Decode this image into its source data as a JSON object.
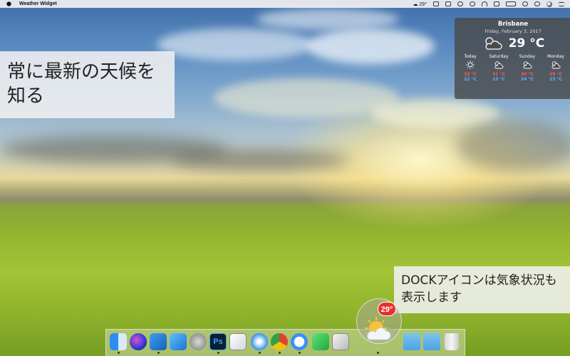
{
  "menubar": {
    "app_name": "Weather Widget",
    "weather_status": "29°"
  },
  "captions": {
    "left": "常に最新の天候を知る",
    "right": "DOCKアイコンは気象状況も表示します"
  },
  "widget": {
    "city": "Brisbane",
    "date": "Friday, February 3, 2017",
    "current_temp": "29 °C",
    "current_icon": "partly-cloudy-icon",
    "forecast": [
      {
        "day": "Today",
        "icon": "sun-icon",
        "high": "32 °C",
        "low": "22 °C"
      },
      {
        "day": "Saturday",
        "icon": "partly-cloudy-icon",
        "high": "31 °C",
        "low": "23 °C"
      },
      {
        "day": "Sunday",
        "icon": "partly-cloudy-icon",
        "high": "30 °C",
        "low": "24 °C"
      },
      {
        "day": "Monday",
        "icon": "partly-cloudy-icon",
        "high": "29 °C",
        "low": "23 °C"
      }
    ],
    "colors": {
      "high": "#ff5b4f",
      "low": "#59b3ff"
    }
  },
  "dock": {
    "weather_badge": "29°",
    "apps": [
      "finder-icon",
      "siri-icon",
      "xcode-icon",
      "app-store-icon",
      "launchpad-icon",
      "photoshop-icon",
      "preview-icon",
      "safari-icon",
      "chrome-icon",
      "messages-icon",
      "facetime-icon",
      "image-capture-icon",
      "weather-widget-icon",
      "applications-folder-icon",
      "downloads-folder-icon",
      "trash-icon"
    ],
    "photoshop_label": "Ps"
  }
}
